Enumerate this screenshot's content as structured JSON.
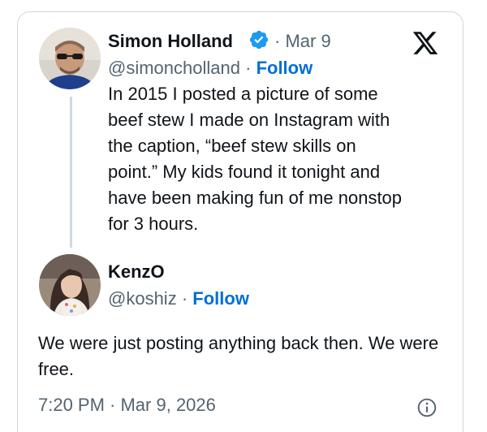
{
  "original_tweet": {
    "display_name": "Simon Holland",
    "date": "· Mar 9",
    "handle": "@simoncholland",
    "separator": "·",
    "follow_label": "Follow",
    "text": "In 2015 I posted a picture of some\nbeef stew I made on Instagram with\nthe caption, “beef stew skills on\npoint.” My kids found it tonight and\nhave been making fun of me nonstop\nfor 3 hours.",
    "verified_icon": "verified-badge-icon"
  },
  "reply": {
    "display_name": "KenzO",
    "handle": "@koshiz",
    "separator": "·",
    "follow_label": "Follow",
    "text": "We were just posting anything back then. We were free."
  },
  "footer": {
    "timestamp": "7:20 PM · Mar 9, 2026",
    "info_icon": "info-icon"
  },
  "colors": {
    "link_blue": "#006fd6",
    "verified_blue": "#1d9bf0",
    "secondary_text": "#536471",
    "border": "#cfd9de"
  },
  "icons": [
    "x-logo-icon",
    "verified-badge-icon",
    "info-icon"
  ]
}
